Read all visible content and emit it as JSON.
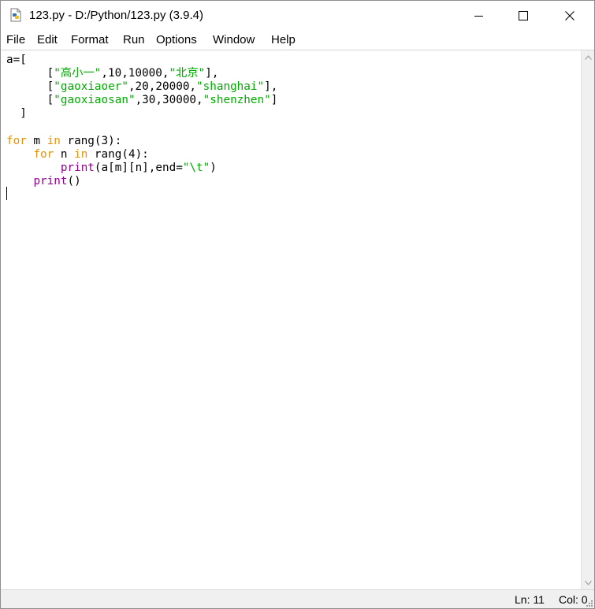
{
  "window": {
    "title": "123.py - D:/Python/123.py (3.9.4)",
    "app_icon": "python-file-icon"
  },
  "controls": {
    "minimize_icon": "minimize-icon",
    "maximize_icon": "maximize-icon",
    "close_icon": "close-icon"
  },
  "menu": {
    "items": [
      "File",
      "Edit",
      "Format",
      "Run",
      "Options",
      "Window",
      "Help"
    ]
  },
  "editor": {
    "lines": [
      [
        {
          "t": "a=["
        }
      ],
      [
        {
          "t": "      ["
        },
        {
          "t": "\"高小一\"",
          "c": "st"
        },
        {
          "t": ",10,10000,"
        },
        {
          "t": "\"北京\"",
          "c": "st"
        },
        {
          "t": "],"
        }
      ],
      [
        {
          "t": "      ["
        },
        {
          "t": "\"gaoxiaoer\"",
          "c": "st"
        },
        {
          "t": ",20,20000,"
        },
        {
          "t": "\"shanghai\"",
          "c": "st"
        },
        {
          "t": "],"
        }
      ],
      [
        {
          "t": "      ["
        },
        {
          "t": "\"gaoxiaosan\"",
          "c": "st"
        },
        {
          "t": ",30,30000,"
        },
        {
          "t": "\"shenzhen\"",
          "c": "st"
        },
        {
          "t": "]"
        }
      ],
      [
        {
          "t": "  ]"
        }
      ],
      [
        {
          "t": ""
        }
      ],
      [
        {
          "t": "for",
          "c": "kw"
        },
        {
          "t": " m "
        },
        {
          "t": "in",
          "c": "kw"
        },
        {
          "t": " rang(3):"
        }
      ],
      [
        {
          "t": "    "
        },
        {
          "t": "for",
          "c": "kw"
        },
        {
          "t": " n "
        },
        {
          "t": "in",
          "c": "kw"
        },
        {
          "t": " rang(4):"
        }
      ],
      [
        {
          "t": "        "
        },
        {
          "t": "print",
          "c": "bi"
        },
        {
          "t": "(a[m][n],end="
        },
        {
          "t": "\"\\t\"",
          "c": "st"
        },
        {
          "t": ")"
        }
      ],
      [
        {
          "t": "    "
        },
        {
          "t": "print",
          "c": "bi"
        },
        {
          "t": "()"
        }
      ],
      [
        {
          "t": ""
        }
      ]
    ],
    "colors": {
      "keyword": "#e8920b",
      "builtin": "#900090",
      "string": "#00aa00"
    }
  },
  "status": {
    "line": "Ln: 11",
    "col": "Col: 0"
  }
}
